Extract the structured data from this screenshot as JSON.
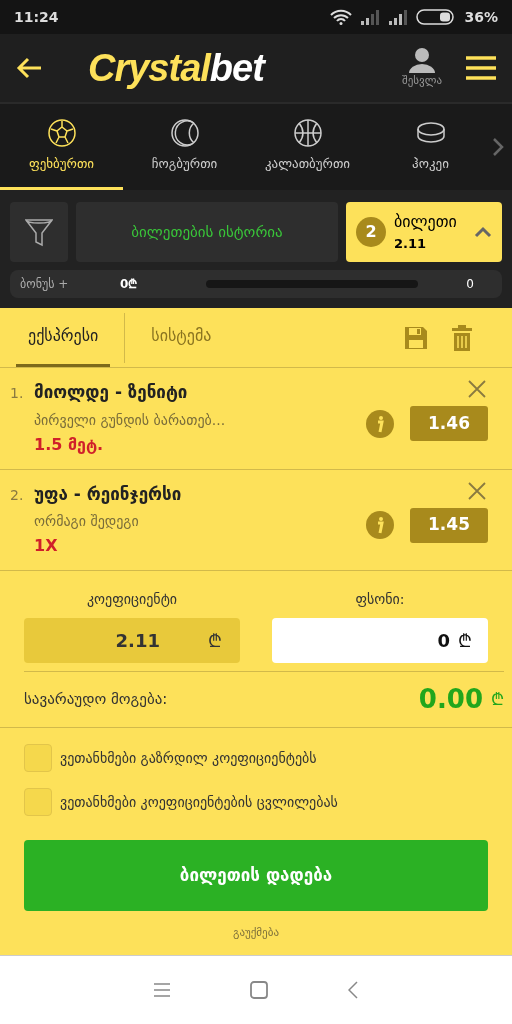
{
  "status_bar": {
    "time": "11:24",
    "battery": "36%"
  },
  "header": {
    "logo_main": "Crystal",
    "logo_accent": "bet",
    "login_label": "შესვლა"
  },
  "sports": [
    {
      "label": "ფეხბურთი",
      "kind": "football",
      "selected": true
    },
    {
      "label": "ჩოგბურთი",
      "kind": "tennis",
      "selected": false
    },
    {
      "label": "კალათბურთი",
      "kind": "basketball",
      "selected": false
    },
    {
      "label": "ჰოკეი",
      "kind": "hockey",
      "selected": false
    }
  ],
  "history_button": "ბილეთების ისტორია",
  "ticket": {
    "count": "2",
    "label": "ბილეთი",
    "odds": "2.11"
  },
  "bonus": {
    "label": "ბონუს +",
    "amount": "0₾",
    "count": "0"
  },
  "slip_tabs": [
    {
      "label": "ექსპრესი",
      "selected": true
    },
    {
      "label": "სისტემა",
      "selected": false
    }
  ],
  "bets": [
    {
      "number": "1.",
      "match": "მიოლდე - ზენიტი",
      "market": "პირველი გუნდის ბარათებ...",
      "pick": "1.5 მეტ.",
      "odds": "1.46"
    },
    {
      "number": "2.",
      "match": "უფა - რეინჯერსი",
      "market": "ორმაგი შედეგი",
      "pick": "1X",
      "odds": "1.45"
    }
  ],
  "coefficient": {
    "label": "კოეფიციენტი",
    "value": "2.11",
    "currency": "₾"
  },
  "stake": {
    "label": "ფსონი:",
    "value": "0",
    "currency": "₾"
  },
  "potential_win": {
    "label": "სავარაუდო მოგება:",
    "value": "0.00",
    "currency": "₾"
  },
  "options": [
    {
      "label": "ვეთანხმები გაზრდილ კოეფიციენტებს",
      "checked": false
    },
    {
      "label": "ვეთანხმები კოეფიციენტების ცვლილებას",
      "checked": false
    }
  ],
  "place_bet_button": "ბილეთის დადება",
  "cancel_link": "გაუქმება"
}
